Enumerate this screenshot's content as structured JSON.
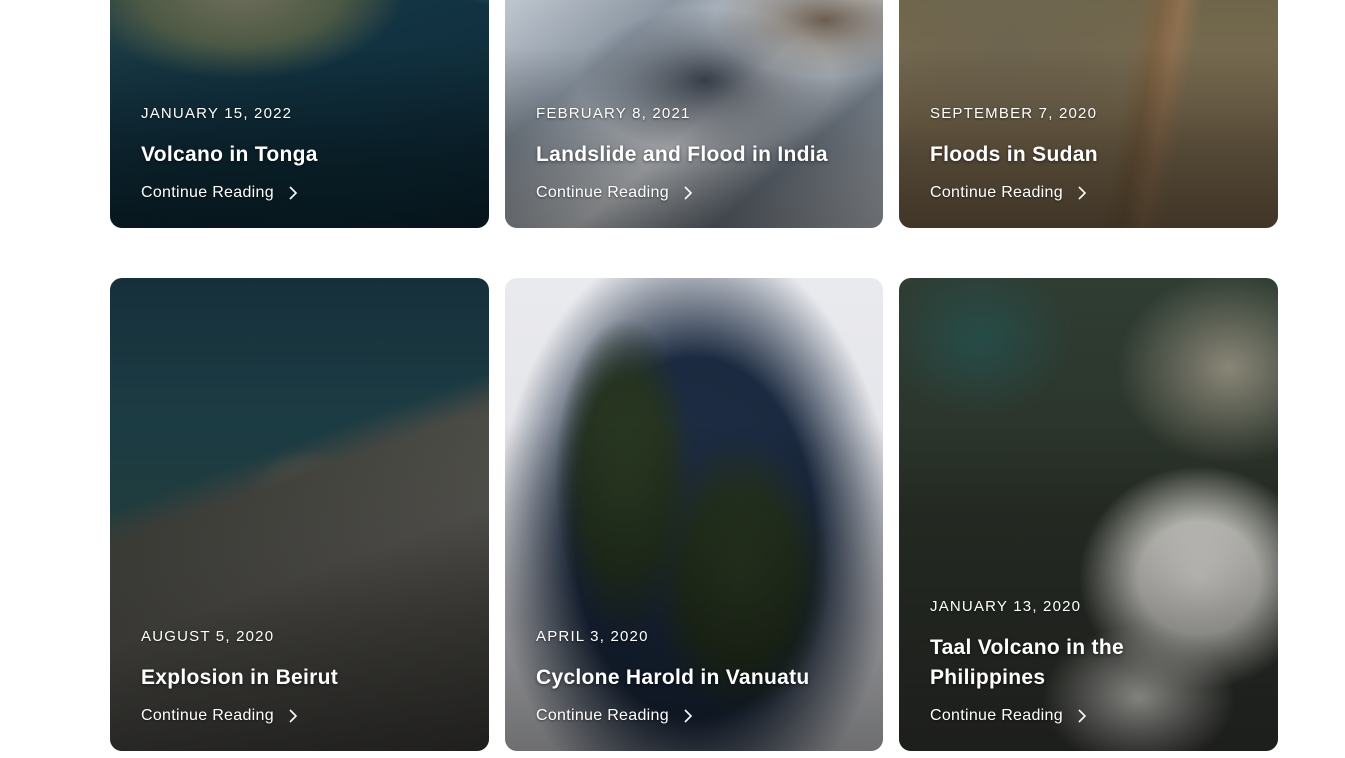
{
  "cards": [
    {
      "date": "JANUARY 15, 2022",
      "title": "Volcano in Tonga",
      "cta": "Continue Reading"
    },
    {
      "date": "FEBRUARY 8, 2021",
      "title": "Landslide and Flood in India",
      "cta": "Continue Reading"
    },
    {
      "date": "SEPTEMBER 7, 2020",
      "title": "Floods in Sudan",
      "cta": "Continue Reading"
    },
    {
      "date": "AUGUST 5, 2020",
      "title": "Explosion in Beirut",
      "cta": "Continue Reading"
    },
    {
      "date": "APRIL 3, 2020",
      "title": "Cyclone Harold in Vanuatu",
      "cta": "Continue Reading"
    },
    {
      "date": "JANUARY 13, 2020",
      "title": "Taal Volcano in the Philippines",
      "cta": "Continue Reading"
    }
  ],
  "icons": {
    "cta_icon": "chevron-right-icon"
  },
  "colors": {
    "card_text": "#ffffff",
    "page_background": "#ffffff"
  }
}
